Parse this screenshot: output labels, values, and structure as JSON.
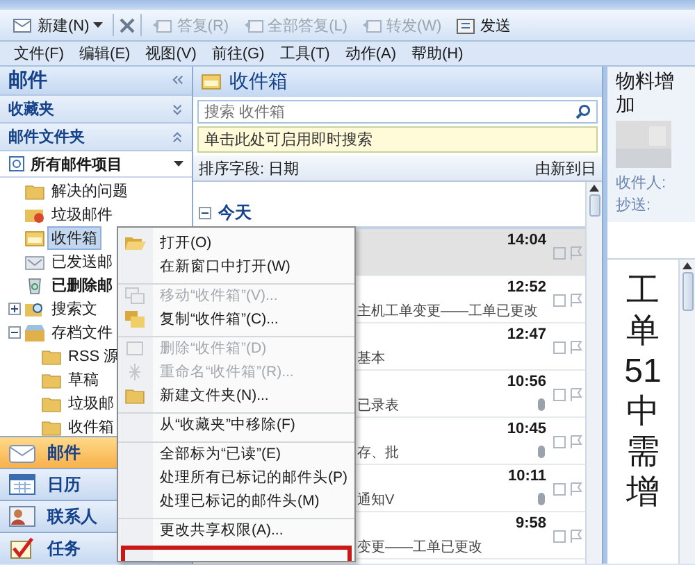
{
  "toolbar": [
    {
      "kind": "new",
      "label": "新建(N)",
      "disabled": false
    },
    {
      "kind": "delete",
      "disabled": false
    },
    {
      "kind": "reply",
      "label": "答复(R)",
      "disabled": true
    },
    {
      "kind": "reply",
      "label": "全部答复(L)",
      "disabled": true
    },
    {
      "kind": "reply",
      "label": "转发(W)",
      "disabled": true
    },
    {
      "kind": "send",
      "label": "发送",
      "disabled": false
    }
  ],
  "menu_bar": [
    "文件(F)",
    "编辑(E)",
    "视图(V)",
    "前往(G)",
    "工具(T)",
    "动作(A)",
    "帮助(H)"
  ],
  "navigation": {
    "title": "邮件",
    "pane_expanded": true,
    "sections": [
      {
        "label": "收藏夹",
        "expanded": false
      },
      {
        "label": "邮件文件夹",
        "expanded": true
      }
    ],
    "folder_view": "所有邮件项目",
    "folders": [
      {
        "name": "解决的问题",
        "kind": "folder",
        "selected": false,
        "has_unread": false
      },
      {
        "name": "垃圾邮件",
        "kind": "junk",
        "selected": false,
        "has_unread": false
      },
      {
        "name": "收件箱",
        "kind": "inbox",
        "selected": true,
        "has_unread": false
      },
      {
        "name": "已发送邮",
        "kind": "sent",
        "selected": false,
        "has_unread": false
      },
      {
        "name": "已删除邮",
        "kind": "trash",
        "selected": false,
        "has_unread": true
      },
      {
        "name": "搜索文",
        "kind": "search",
        "selected": false,
        "has_unread": false,
        "expanded": false
      },
      {
        "name": "存档文件",
        "kind": "archive",
        "selected": false,
        "has_unread": false,
        "expanded": true,
        "children": [
          {
            "name": "RSS 源",
            "kind": "folder",
            "selected": false,
            "has_unread": false
          },
          {
            "name": "草稿",
            "kind": "folder",
            "selected": false,
            "has_unread": false
          },
          {
            "name": "垃圾邮",
            "kind": "folder",
            "selected": false,
            "has_unread": false
          },
          {
            "name": "收件箱",
            "kind": "folder",
            "selected": false,
            "has_unread": false
          }
        ]
      }
    ],
    "buttons": [
      {
        "label": "邮件",
        "kind": "mail",
        "selected": true
      },
      {
        "label": "日历",
        "kind": "calendar",
        "selected": false
      },
      {
        "label": "联系人",
        "kind": "contacts",
        "selected": false
      },
      {
        "label": "任务",
        "kind": "tasks",
        "selected": false
      }
    ]
  },
  "mail_list": {
    "title": "收件箱",
    "search": {
      "placeholder": "搜索 收件箱"
    },
    "instant_search_bar": "单击此处可启用即时搜索",
    "sort_label": "排序字段: 日期",
    "sort_order": "由新到日",
    "group": {
      "label": "今天",
      "expanded": true
    },
    "messages": [
      {
        "time": "14:04",
        "selected": true,
        "attachment": false
      },
      {
        "time": "12:52",
        "snippet": "主机工单变更——工单已更改",
        "selected": false,
        "attachment": false
      },
      {
        "time": "12:47",
        "snippet": "基本",
        "selected": false,
        "attachment": false
      },
      {
        "time": "10:56",
        "snippet": "已录表",
        "selected": false,
        "attachment": true
      },
      {
        "time": "10:45",
        "snippet": "存、批",
        "selected": false,
        "attachment": true
      },
      {
        "time": "10:11",
        "snippet": "通知V",
        "selected": false,
        "attachment": true
      },
      {
        "time": "9:58",
        "snippet": "变更——工单已更改",
        "selected": false,
        "attachment": false
      }
    ]
  },
  "reading_pane": {
    "subject": [
      "物料增",
      "加"
    ],
    "to_label": "收件人:",
    "cc_label": "抄送:",
    "body": [
      "工",
      "单",
      "51",
      "中",
      "需",
      "增"
    ]
  },
  "context_menu": [
    {
      "kind": "open",
      "label": "打开(O)",
      "disabled": false,
      "separator_before": false
    },
    {
      "kind": "plain",
      "label": "在新窗口中打开(W)",
      "disabled": false,
      "separator_before": false
    },
    {
      "kind": "move",
      "label": "移动“收件箱”(V)...",
      "disabled": true,
      "separator_before": true
    },
    {
      "kind": "copy",
      "label": "复制“收件箱”(C)...",
      "disabled": false,
      "separator_before": false
    },
    {
      "kind": "delete",
      "label": "删除“收件箱”(D)",
      "disabled": true,
      "separator_before": true
    },
    {
      "kind": "rename",
      "label": "重命名“收件箱”(R)...",
      "disabled": true,
      "separator_before": false
    },
    {
      "kind": "new_folder",
      "label": "新建文件夹(N)...",
      "disabled": false,
      "separator_before": false
    },
    {
      "kind": "plain",
      "label": "从“收藏夹”中移除(F)",
      "disabled": false,
      "separator_before": true
    },
    {
      "kind": "plain",
      "label": "全部标为“已读”(E)",
      "disabled": false,
      "separator_before": true
    },
    {
      "kind": "plain",
      "label": "处理所有已标记的邮件头(P)",
      "disabled": false,
      "separator_before": false
    },
    {
      "kind": "plain",
      "label": "处理已标记的邮件头(M)",
      "disabled": false,
      "separator_before": false
    },
    {
      "kind": "plain",
      "label": "更改共享权限(A)...",
      "disabled": false,
      "separator_before": true
    },
    {
      "kind": "outlined"
    }
  ]
}
